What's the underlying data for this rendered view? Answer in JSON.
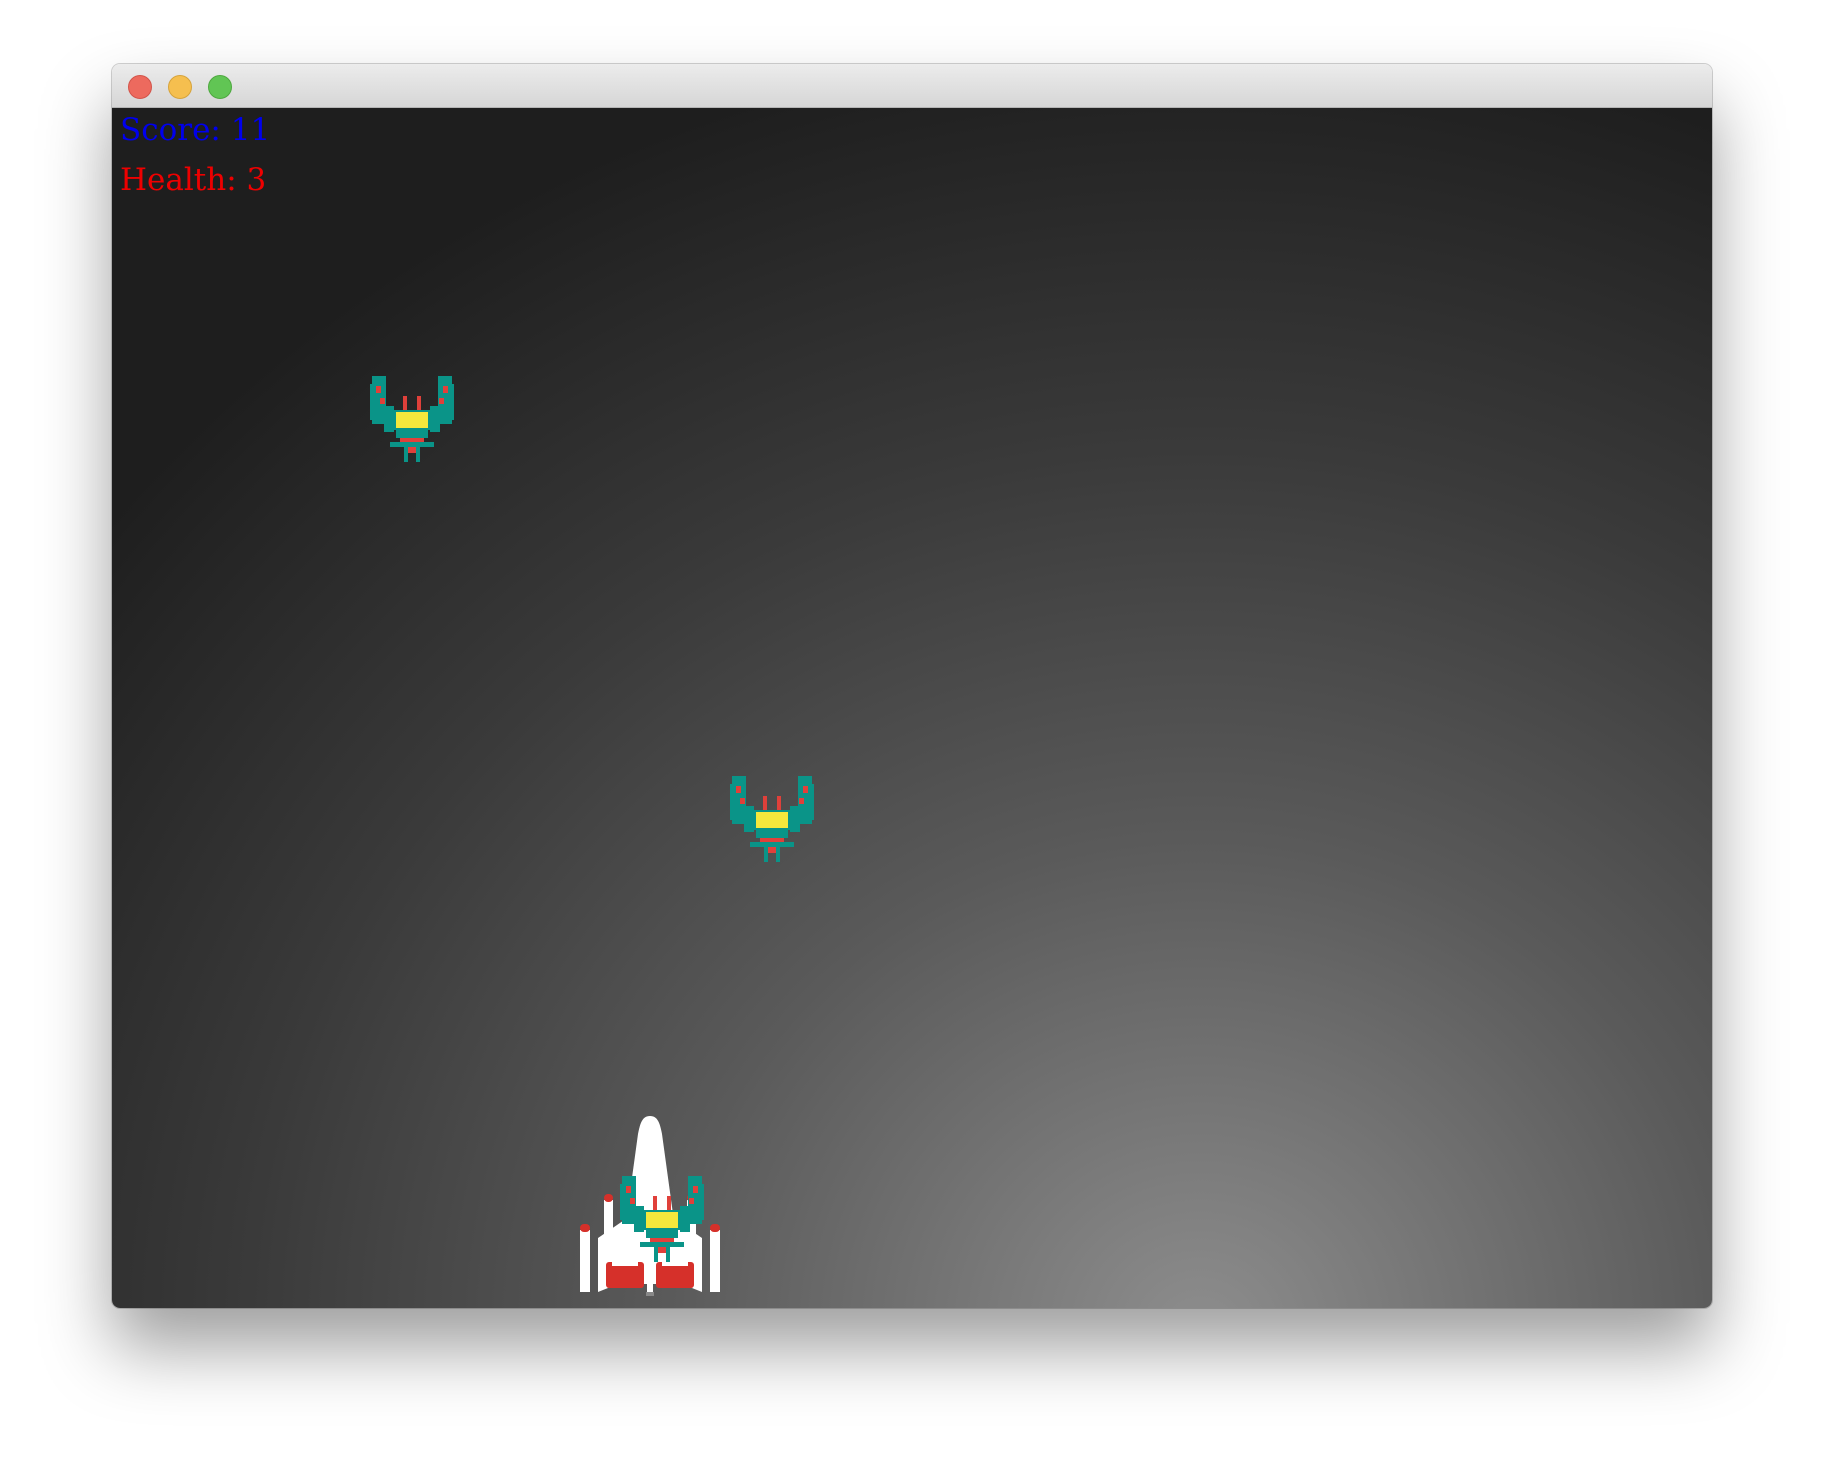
{
  "hud": {
    "score_label": "Score: 11",
    "health_label": "Health: 3",
    "score_color": "#0000ee",
    "health_color": "#ee0000"
  },
  "window": {
    "controls": [
      "close",
      "minimize",
      "maximize"
    ]
  },
  "sprites": {
    "player": "white-red-starfighter",
    "enemies": [
      "teal-yellow-bug-alien",
      "teal-yellow-bug-alien",
      "teal-yellow-bug-alien"
    ]
  },
  "colors": {
    "enemy_teal": "#0a9488",
    "enemy_yellow": "#f5e83c",
    "enemy_red": "#e0403a",
    "player_white": "#ffffff",
    "player_red": "#d6302a"
  }
}
